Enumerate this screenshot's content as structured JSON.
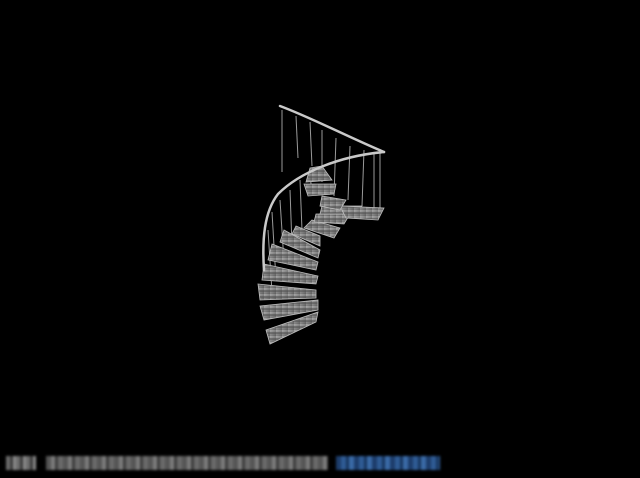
{
  "scene": {
    "subject": "spiral-staircase",
    "colors": {
      "background": "#000000",
      "step_fill": "#8a8a8a",
      "step_edge": "#bdbdbd",
      "rail": "#c9c9c9",
      "baluster": "#9a9a9a"
    }
  }
}
